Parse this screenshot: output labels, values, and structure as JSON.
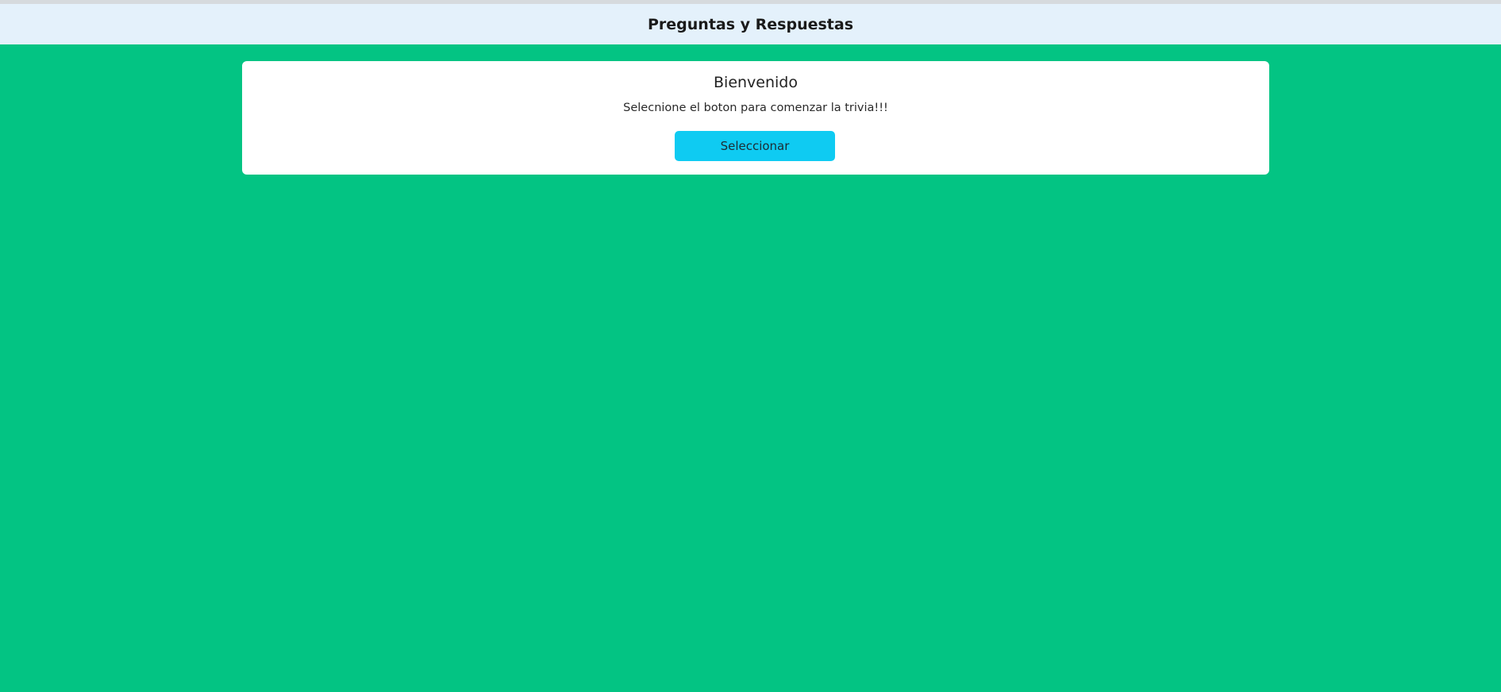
{
  "header": {
    "title": "Preguntas y Respuestas"
  },
  "welcome_card": {
    "title": "Bienvenido",
    "text": "Selecnione el boton para comenzar la trivia!!!",
    "button_label": "Seleccionar"
  },
  "colors": {
    "page_background": "#03c483",
    "header_background": "#e4f1fb",
    "card_background": "#ffffff",
    "button_background": "#0fcbf2"
  }
}
